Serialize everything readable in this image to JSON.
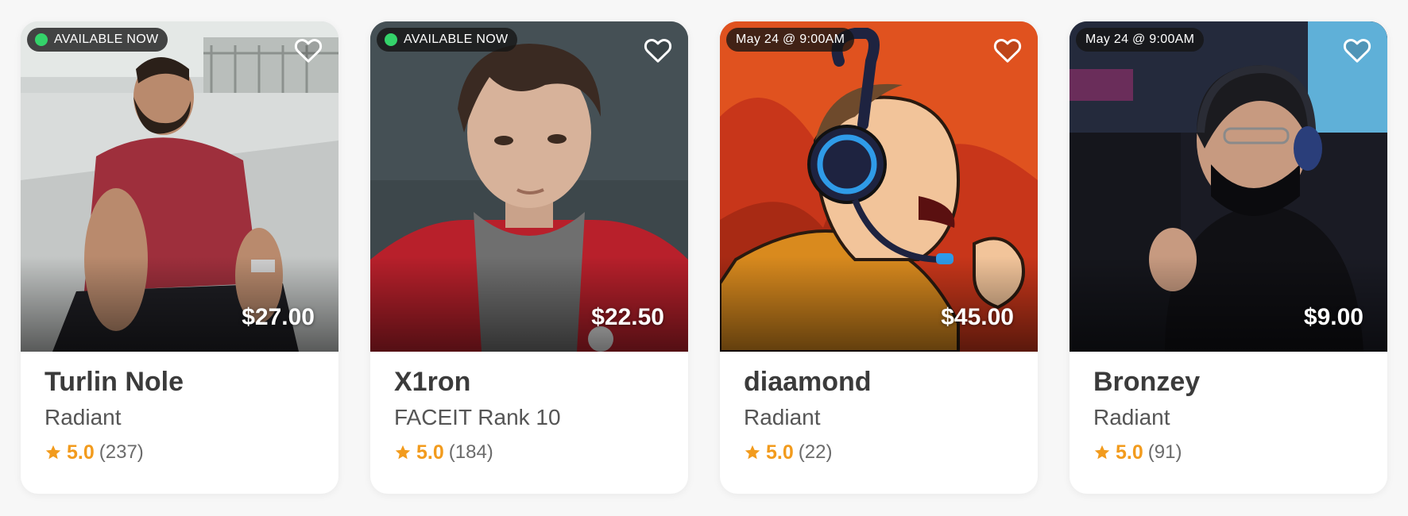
{
  "cards": [
    {
      "badge_type": "available",
      "badge_text": "AVAILABLE NOW",
      "price": "$27.00",
      "name": "Turlin Nole",
      "rank": "Radiant",
      "rating": "5.0",
      "reviews": "(237)",
      "image": "man-in-red-shirt-sitting-photo"
    },
    {
      "badge_type": "available",
      "badge_text": "AVAILABLE NOW",
      "price": "$22.50",
      "name": "X1ron",
      "rank": "FACEIT Rank 10",
      "rating": "5.0",
      "reviews": "(184)",
      "image": "young-man-red-jacket-portrait"
    },
    {
      "badge_type": "scheduled",
      "badge_text": "May 24 @ 9:00AM",
      "price": "$45.00",
      "name": "diaamond",
      "rank": "Radiant",
      "rating": "5.0",
      "reviews": "(22)",
      "image": "cartoon-gamer-headset-shouting"
    },
    {
      "badge_type": "scheduled",
      "badge_text": "May 24 @ 9:00AM",
      "price": "$9.00",
      "name": "Bronzey",
      "rank": "Radiant",
      "rating": "5.0",
      "reviews": "(91)",
      "image": "masked-gamer-headset-photo"
    }
  ],
  "colors": {
    "available_dot": "#34d36a",
    "rating_accent": "#f29b1d",
    "name_text": "#3b3b3b"
  }
}
